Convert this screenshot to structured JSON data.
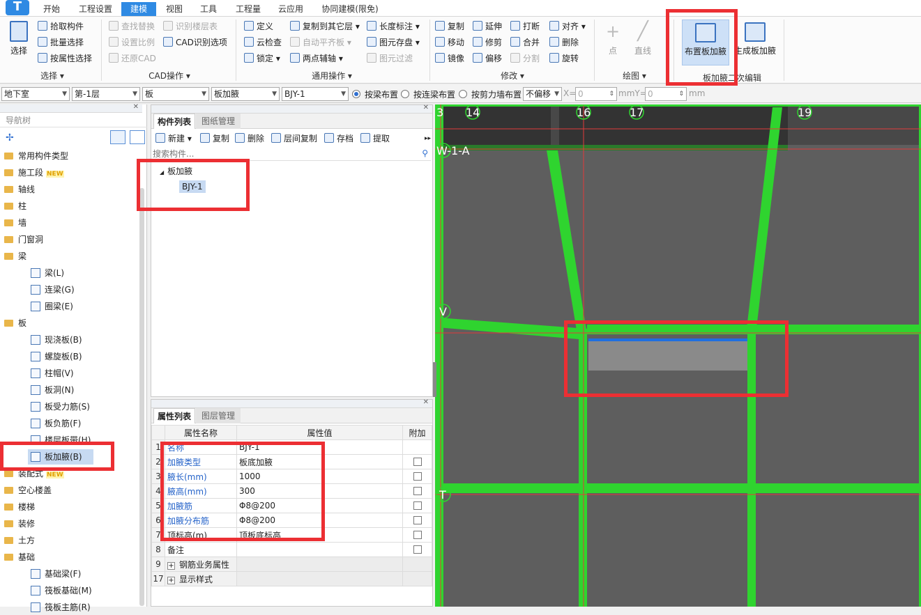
{
  "app": {
    "logo_text": "T"
  },
  "menu": {
    "tabs": [
      "开始",
      "工程设置",
      "建模",
      "视图",
      "工具",
      "工程量",
      "云应用",
      "协同建模(限免)"
    ],
    "active": "建模"
  },
  "ribbon": {
    "select": {
      "label": "选择",
      "group": "选择",
      "items": [
        "拾取构件",
        "批量选择",
        "按属性选择"
      ]
    },
    "cad": {
      "group": "CAD操作",
      "items": [
        "查找替换",
        "识别楼层表",
        "设置比例",
        "CAD识别选项",
        "还原CAD"
      ]
    },
    "general": {
      "group": "通用操作",
      "items": [
        "定义",
        "复制到其它层",
        "长度标注",
        "云检查",
        "自动平齐板",
        "图元存盘",
        "锁定",
        "两点辅轴",
        "图元过滤"
      ]
    },
    "modify": {
      "group": "修改",
      "items": [
        "复制",
        "延伸",
        "打断",
        "对齐",
        "移动",
        "修剪",
        "合并",
        "删除",
        "镜像",
        "偏移",
        "分割",
        "旋转"
      ]
    },
    "draw": {
      "group": "绘图",
      "items": [
        "点",
        "直线"
      ]
    },
    "haunch": {
      "group": "板加腋二次编辑",
      "items": [
        "布置板加腋",
        "生成板加腋"
      ]
    }
  },
  "toolbar": {
    "floor_group": "地下室",
    "floor": "第-1层",
    "category": "板",
    "component_type": "板加腋",
    "component": "BJY-1",
    "radio_options": [
      "按梁布置",
      "按连梁布置",
      "按剪力墙布置"
    ],
    "radio_selected": "按梁布置",
    "offset_mode": "不偏移",
    "x_label": "X=",
    "x_value": "0",
    "y_label": "mmY=",
    "y_value": "0",
    "unit": "mm"
  },
  "nav": {
    "title": "导航树",
    "items": [
      {
        "label": "常用构件类型",
        "type": "folder"
      },
      {
        "label": "施工段",
        "type": "folder",
        "badge": "NEW"
      },
      {
        "label": "轴线",
        "type": "folder"
      },
      {
        "label": "柱",
        "type": "folder"
      },
      {
        "label": "墙",
        "type": "folder"
      },
      {
        "label": "门窗洞",
        "type": "folder"
      },
      {
        "label": "梁",
        "type": "folder"
      },
      {
        "label": "梁(L)",
        "type": "leaf"
      },
      {
        "label": "连梁(G)",
        "type": "leaf"
      },
      {
        "label": "圈梁(E)",
        "type": "leaf"
      },
      {
        "label": "板",
        "type": "folder"
      },
      {
        "label": "现浇板(B)",
        "type": "leaf"
      },
      {
        "label": "螺旋板(B)",
        "type": "leaf"
      },
      {
        "label": "柱帽(V)",
        "type": "leaf"
      },
      {
        "label": "板洞(N)",
        "type": "leaf"
      },
      {
        "label": "板受力筋(S)",
        "type": "leaf"
      },
      {
        "label": "板负筋(F)",
        "type": "leaf"
      },
      {
        "label": "楼层板带(H)",
        "type": "leaf"
      },
      {
        "label": "板加腋(B)",
        "type": "leaf",
        "selected": true
      },
      {
        "label": "装配式",
        "type": "folder",
        "badge": "NEW"
      },
      {
        "label": "空心楼盖",
        "type": "folder"
      },
      {
        "label": "楼梯",
        "type": "folder"
      },
      {
        "label": "装修",
        "type": "folder"
      },
      {
        "label": "土方",
        "type": "folder"
      },
      {
        "label": "基础",
        "type": "folder"
      },
      {
        "label": "基础梁(F)",
        "type": "leaf"
      },
      {
        "label": "筏板基础(M)",
        "type": "leaf"
      },
      {
        "label": "筏板主筋(R)",
        "type": "leaf"
      }
    ]
  },
  "complist": {
    "tabs": [
      "构件列表",
      "图纸管理"
    ],
    "buttons": [
      "新建",
      "复制",
      "删除",
      "层间复制",
      "存档",
      "提取"
    ],
    "search_placeholder": "搜索构件...",
    "tree_root": "板加腋",
    "tree_child": "BJY-1"
  },
  "proplist": {
    "tabs": [
      "属性列表",
      "图层管理"
    ],
    "headers": [
      "属性名称",
      "属性值",
      "附加"
    ],
    "rows": [
      {
        "idx": "1",
        "name": "名称",
        "value": "BJY-1",
        "blue": true,
        "check": false
      },
      {
        "idx": "2",
        "name": "加腋类型",
        "value": "板底加腋",
        "blue": true,
        "check": true
      },
      {
        "idx": "3",
        "name": "腋长(mm)",
        "value": "1000",
        "blue": true,
        "check": true
      },
      {
        "idx": "4",
        "name": "腋高(mm)",
        "value": "300",
        "blue": true,
        "check": true
      },
      {
        "idx": "5",
        "name": "加腋筋",
        "value": "Φ8@200",
        "blue": true,
        "check": true
      },
      {
        "idx": "6",
        "name": "加腋分布筋",
        "value": "Φ8@200",
        "blue": true,
        "check": true
      },
      {
        "idx": "7",
        "name": "顶标高(m)",
        "value": "顶板底标高",
        "blue": false,
        "check": true
      },
      {
        "idx": "8",
        "name": "备注",
        "value": "",
        "blue": false,
        "check": true
      },
      {
        "idx": "9",
        "name": "钢筋业务属性",
        "value": "",
        "blue": false,
        "check": false,
        "group": true
      },
      {
        "idx": "17",
        "name": "显示样式",
        "value": "",
        "blue": false,
        "check": false,
        "group": true
      }
    ]
  },
  "canvas": {
    "axis_top": [
      "3",
      "14",
      "16",
      "17",
      "19"
    ],
    "axis_left": [
      "W-1-A",
      "V",
      "T"
    ],
    "colors": {
      "background": "#5e5e5e",
      "beam": "#2fd42f",
      "highlight": "#ec2f33",
      "haunch_edge": "#1f6fe0"
    }
  }
}
